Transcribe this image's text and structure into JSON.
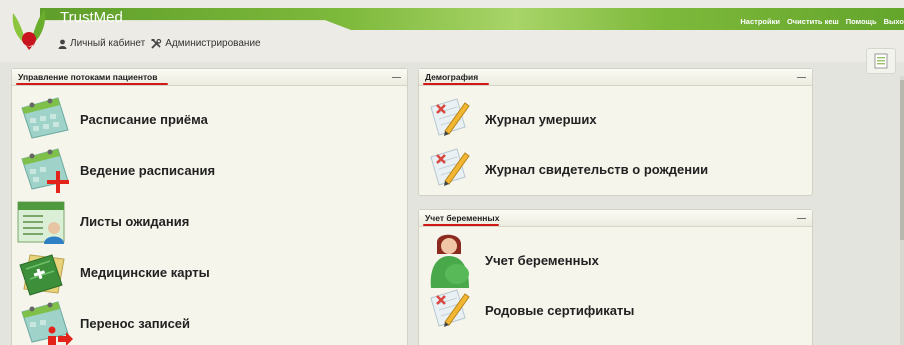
{
  "app": {
    "title": "TrustMed"
  },
  "top_links": [
    "Настройки",
    "Очистить кеш",
    "Помощь",
    "Выхо"
  ],
  "subnav": {
    "cabinet": "Личный кабинет",
    "admin": "Администрирование"
  },
  "panels": {
    "patient_flow": {
      "title": "Управление потоками пациентов",
      "collapse": "—",
      "items": [
        "Расписание приёма",
        "Ведение расписания",
        "Листы ожидания",
        "Медицинские карты",
        "Перенос записей"
      ]
    },
    "demography": {
      "title": "Демография",
      "collapse": "—",
      "items": [
        "Журнал умерших",
        "Журнал свидетельств о рождении"
      ]
    },
    "pregnancy": {
      "title": "Учет беременных",
      "collapse": "—",
      "items": [
        "Учет беременных",
        "Родовые сертификаты"
      ]
    }
  },
  "colors": {
    "brand_green": "#7db93b",
    "accent_red": "#d01818",
    "panel_bg": "#f6f5ec"
  }
}
